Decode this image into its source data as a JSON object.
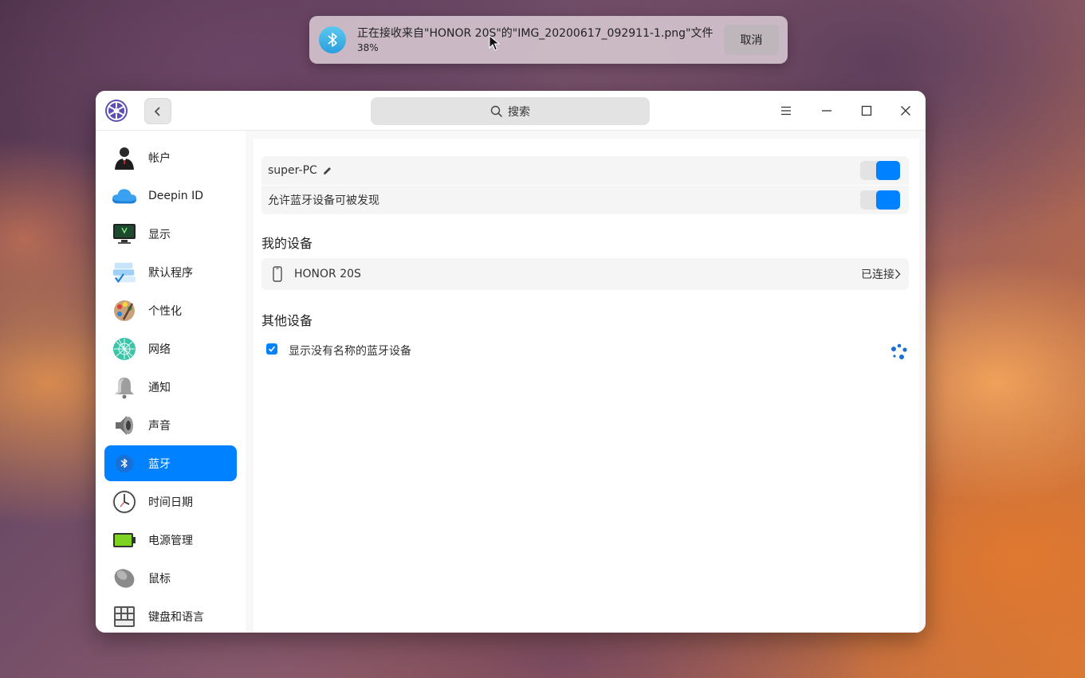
{
  "notification": {
    "message": "正在接收来自\"HONOR 20S\"的\"IMG_20200617_092911-1.png\"文件",
    "progress_text": "38%",
    "progress_value": 0.38,
    "cancel_label": "取消",
    "icon": "bluetooth-icon"
  },
  "titlebar": {
    "search_placeholder": "搜索",
    "icons": [
      "settings-logo-icon",
      "back-arrow-icon",
      "search-icon",
      "menu-icon",
      "minimize-icon",
      "maximize-icon",
      "close-icon"
    ]
  },
  "sidebar": {
    "items": [
      {
        "label": "帐户",
        "icon": "account-icon"
      },
      {
        "label": "Deepin ID",
        "icon": "cloud-icon"
      },
      {
        "label": "显示",
        "icon": "display-icon"
      },
      {
        "label": "默认程序",
        "icon": "default-apps-icon"
      },
      {
        "label": "个性化",
        "icon": "palette-icon"
      },
      {
        "label": "网络",
        "icon": "network-icon"
      },
      {
        "label": "通知",
        "icon": "bell-icon"
      },
      {
        "label": "声音",
        "icon": "speaker-icon"
      },
      {
        "label": "蓝牙",
        "icon": "bluetooth-icon",
        "active": true
      },
      {
        "label": "时间日期",
        "icon": "clock-icon"
      },
      {
        "label": "电源管理",
        "icon": "battery-icon"
      },
      {
        "label": "鼠标",
        "icon": "mouse-icon"
      },
      {
        "label": "键盘和语言",
        "icon": "keyboard-icon"
      }
    ]
  },
  "bluetooth": {
    "device_name": "super-PC",
    "device_toggle_on": true,
    "discoverable_label": "允许蓝牙设备可被发现",
    "discoverable_on": true,
    "my_devices_title": "我的设备",
    "my_devices": [
      {
        "name": "HONOR 20S",
        "status": "已连接"
      }
    ],
    "other_devices_title": "其他设备",
    "show_unnamed_label": "显示没有名称的蓝牙设备",
    "show_unnamed_checked": true
  },
  "colors": {
    "accent": "#0081ff",
    "notification_bg": "#d7c8d2"
  }
}
